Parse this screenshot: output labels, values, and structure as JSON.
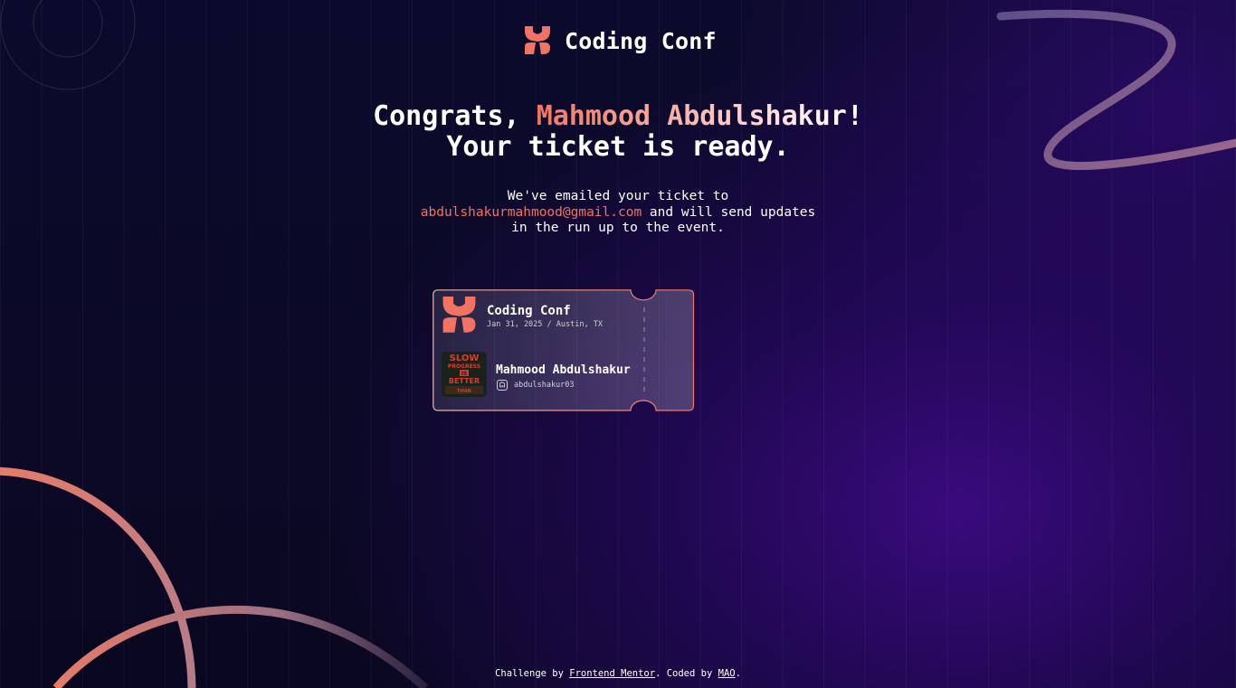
{
  "brand": {
    "name": "Coding Conf",
    "logo_icon": "coding-conf-logo-icon"
  },
  "headline": {
    "prefix": "Congrats, ",
    "name": "Mahmood Abdulshakur",
    "suffix": "!",
    "line2": "Your ticket is ready."
  },
  "message": {
    "line1": "We've emailed your ticket to",
    "email": "abdulshakurmahmood@gmail.com",
    "line2_rest": " and will send updates",
    "line3": "in the run up to the event."
  },
  "ticket": {
    "conf_name": "Coding Conf",
    "date_location": "Jan 31, 2025 / Austin, TX",
    "attendee_name": "Mahmood Abdulshakur",
    "github_handle": "abdulshakur03",
    "github_icon": "github-icon",
    "avatar_text": [
      "SLOW",
      "PROGRESS",
      "IS",
      "BETTER",
      "THAN"
    ]
  },
  "footer": {
    "challenge_prefix": "Challenge by ",
    "frontend_mentor_link": "Frontend Mentor",
    "coded_by_prefix": ". Coded by ",
    "author_link": "MAO",
    "end": "."
  },
  "colors": {
    "accent": "#f37362",
    "background": "#0c0a2c",
    "purple_glow": "#3c0a82",
    "ticket_border": "#f37362"
  }
}
